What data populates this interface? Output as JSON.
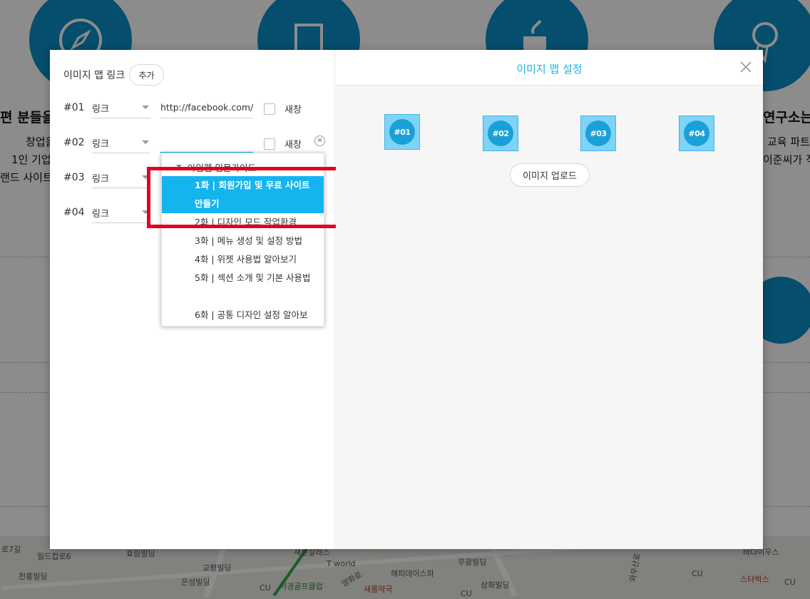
{
  "background": {
    "left_heading": "편 분들을",
    "left_lines": [
      "창업을",
      "1인 기업",
      "랜드 사이트"
    ],
    "right_heading": "연구소는",
    "right_lines": [
      "교육 파트",
      "이준씨가 직"
    ],
    "map_labels": [
      "로7길",
      "월드컵로6",
      "천홍빌딩",
      "효림빌딩",
      "교평빌딩",
      "은성빌딩",
      "CU",
      "서경골프클럽",
      "새른살레스",
      "T world",
      "양화로",
      "해피데이스파",
      "새롬약국",
      "무광빌딩",
      "삼화빌딩",
      "CU",
      "와우산로",
      "CU",
      "바다이우스",
      "스타벅스",
      "CU"
    ]
  },
  "left_panel": {
    "title": "이미지 맵 링크",
    "add_button": "추가",
    "new_window_label": "새창",
    "rows": [
      {
        "num": "#01",
        "type": "링크",
        "url": "http://facebook.com/"
      },
      {
        "num": "#02",
        "type": "링크",
        "url": ""
      },
      {
        "num": "#03",
        "type": "링크"
      },
      {
        "num": "#04",
        "type": "링크"
      }
    ]
  },
  "dropdown": {
    "group": "아임웹 입문가이드",
    "items": [
      "1화 | 회원가입 및 무료 사이트 만들기",
      "2화 | 디자인 모드 작업환경",
      "3화 | 메뉴 생성 및 설정 방법",
      "4화 | 위젯 사용법 알아보기",
      "5화 | 섹션 소개 및 기본 사용법",
      "6화 | 공통 디자인 설정 알아보"
    ],
    "selected_index": 0
  },
  "right_panel": {
    "title": "이미지 맵 설정",
    "areas": [
      "#01",
      "#02",
      "#03",
      "#04"
    ],
    "upload_button": "이미지 업로드"
  },
  "colors": {
    "accent": "#14b4ef",
    "highlight": "#e4001d",
    "brand_blue": "#0a8ec6"
  }
}
